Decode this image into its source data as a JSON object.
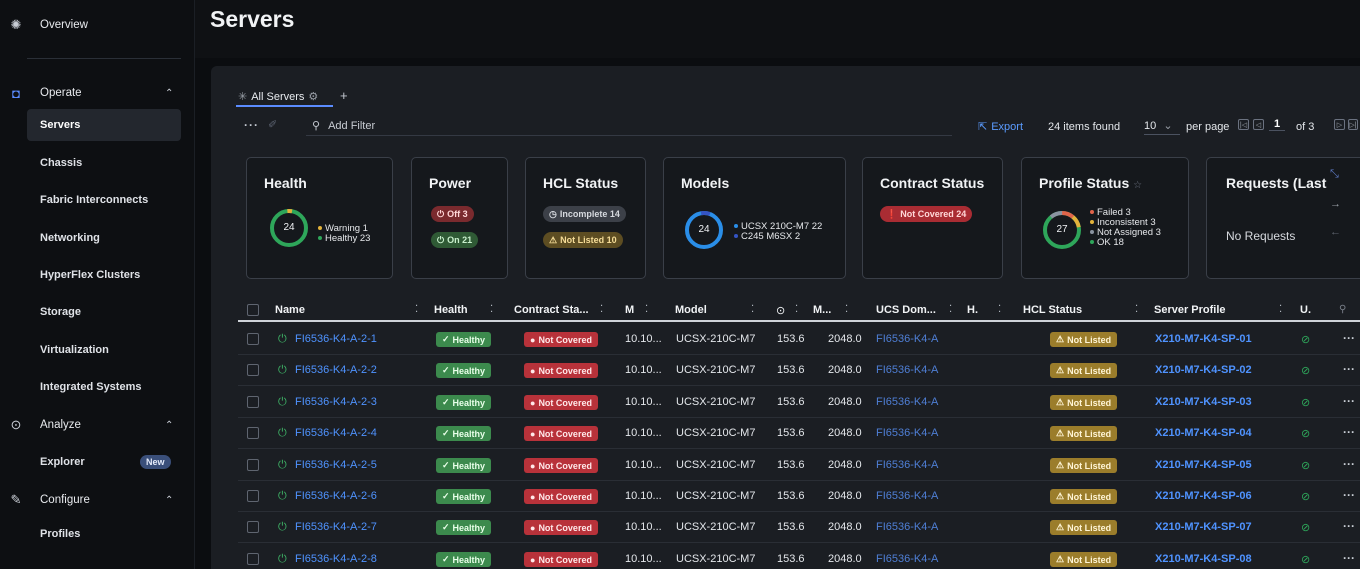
{
  "sidebar": {
    "overview": "Overview",
    "operate": "Operate",
    "operate_items": [
      "Servers",
      "Chassis",
      "Fabric Interconnects",
      "Networking",
      "HyperFlex Clusters",
      "Storage",
      "Virtualization",
      "Integrated Systems"
    ],
    "analyze": "Analyze",
    "explorer": "Explorer",
    "new_badge": "New",
    "configure": "Configure",
    "profiles": "Profiles"
  },
  "header": {
    "title": "Servers"
  },
  "tabs": {
    "all_servers": "All Servers",
    "add": "+"
  },
  "toolbar": {
    "filter_placeholder": "Add Filter",
    "export": "Export",
    "items_found": "24 items found",
    "per_page_value": "10",
    "per_page_label": "per page",
    "page_current": "1",
    "page_of": "of 3"
  },
  "cards": {
    "health": {
      "title": "Health",
      "total": "24",
      "legend": [
        "Warning 1",
        "Healthy 23"
      ]
    },
    "power": {
      "title": "Power",
      "off": "Off 3",
      "on": "On 21"
    },
    "hcl": {
      "title": "HCL Status",
      "incomplete": "Incomplete 14",
      "not_listed": "Not Listed 10"
    },
    "models": {
      "title": "Models",
      "total": "24",
      "legend": [
        "UCSX 210C-M7  22",
        "C245 M6SX  2"
      ]
    },
    "contract": {
      "title": "Contract Status",
      "not_covered": "Not Covered 24"
    },
    "profile": {
      "title": "Profile Status",
      "total": "27",
      "legend": [
        "Failed  3",
        "Inconsistent  3",
        "Not Assigned  3",
        "OK  18"
      ]
    },
    "requests": {
      "title": "Requests (Last",
      "empty": "No Requests"
    }
  },
  "table": {
    "headers": [
      "Name",
      "Health",
      "Contract Sta...",
      "M",
      "Model",
      "M...",
      "UCS Dom...",
      "H.",
      "HCL Status",
      "Server Profile",
      "U."
    ],
    "rows": [
      {
        "name": "FI6536-K4-A-2-1",
        "health": "Healthy",
        "contract": "Not Covered",
        "mgmt": "10.10...",
        "model": "UCSX-210C-M7",
        "cpu": "153.6",
        "mem": "2048.0",
        "domain": "FI6536-K4-A",
        "hcl": "Not Listed",
        "profile": "X210-M7-K4-SP-01"
      },
      {
        "name": "FI6536-K4-A-2-2",
        "health": "Healthy",
        "contract": "Not Covered",
        "mgmt": "10.10...",
        "model": "UCSX-210C-M7",
        "cpu": "153.6",
        "mem": "2048.0",
        "domain": "FI6536-K4-A",
        "hcl": "Not Listed",
        "profile": "X210-M7-K4-SP-02"
      },
      {
        "name": "FI6536-K4-A-2-3",
        "health": "Healthy",
        "contract": "Not Covered",
        "mgmt": "10.10...",
        "model": "UCSX-210C-M7",
        "cpu": "153.6",
        "mem": "2048.0",
        "domain": "FI6536-K4-A",
        "hcl": "Not Listed",
        "profile": "X210-M7-K4-SP-03"
      },
      {
        "name": "FI6536-K4-A-2-4",
        "health": "Healthy",
        "contract": "Not Covered",
        "mgmt": "10.10...",
        "model": "UCSX-210C-M7",
        "cpu": "153.6",
        "mem": "2048.0",
        "domain": "FI6536-K4-A",
        "hcl": "Not Listed",
        "profile": "X210-M7-K4-SP-04"
      },
      {
        "name": "FI6536-K4-A-2-5",
        "health": "Healthy",
        "contract": "Not Covered",
        "mgmt": "10.10...",
        "model": "UCSX-210C-M7",
        "cpu": "153.6",
        "mem": "2048.0",
        "domain": "FI6536-K4-A",
        "hcl": "Not Listed",
        "profile": "X210-M7-K4-SP-05"
      },
      {
        "name": "FI6536-K4-A-2-6",
        "health": "Healthy",
        "contract": "Not Covered",
        "mgmt": "10.10...",
        "model": "UCSX-210C-M7",
        "cpu": "153.6",
        "mem": "2048.0",
        "domain": "FI6536-K4-A",
        "hcl": "Not Listed",
        "profile": "X210-M7-K4-SP-06"
      },
      {
        "name": "FI6536-K4-A-2-7",
        "health": "Healthy",
        "contract": "Not Covered",
        "mgmt": "10.10...",
        "model": "UCSX-210C-M7",
        "cpu": "153.6",
        "mem": "2048.0",
        "domain": "FI6536-K4-A",
        "hcl": "Not Listed",
        "profile": "X210-M7-K4-SP-07"
      },
      {
        "name": "FI6536-K4-A-2-8",
        "health": "Healthy",
        "contract": "Not Covered",
        "mgmt": "10.10...",
        "model": "UCSX-210C-M7",
        "cpu": "153.6",
        "mem": "2048.0",
        "domain": "FI6536-K4-A",
        "hcl": "Not Listed",
        "profile": "X210-M7-K4-SP-08"
      }
    ]
  },
  "colors": {
    "accent": "#5b8cff",
    "healthy": "#3c8a4d",
    "not_covered": "#b8323a",
    "not_listed": "#9b7d2b"
  }
}
